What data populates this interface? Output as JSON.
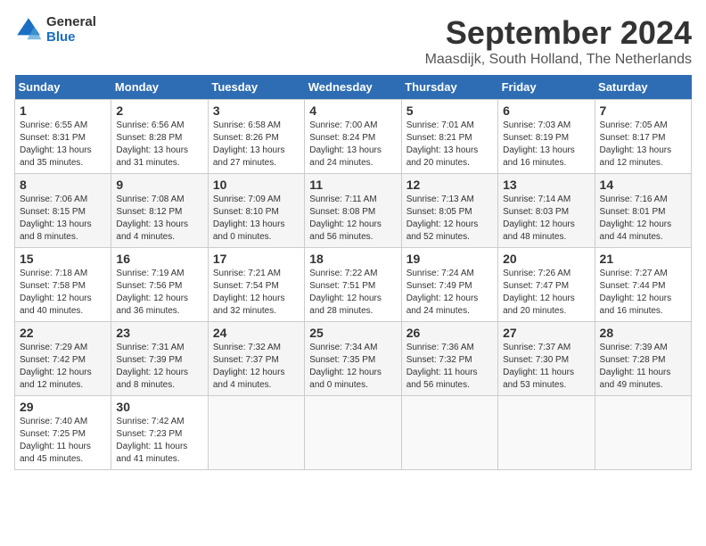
{
  "header": {
    "logo_line1": "General",
    "logo_line2": "Blue",
    "month_title": "September 2024",
    "location": "Maasdijk, South Holland, The Netherlands"
  },
  "days_of_week": [
    "Sunday",
    "Monday",
    "Tuesday",
    "Wednesday",
    "Thursday",
    "Friday",
    "Saturday"
  ],
  "weeks": [
    [
      {
        "day": "1",
        "info": "Sunrise: 6:55 AM\nSunset: 8:31 PM\nDaylight: 13 hours and 35 minutes."
      },
      {
        "day": "2",
        "info": "Sunrise: 6:56 AM\nSunset: 8:28 PM\nDaylight: 13 hours and 31 minutes."
      },
      {
        "day": "3",
        "info": "Sunrise: 6:58 AM\nSunset: 8:26 PM\nDaylight: 13 hours and 27 minutes."
      },
      {
        "day": "4",
        "info": "Sunrise: 7:00 AM\nSunset: 8:24 PM\nDaylight: 13 hours and 24 minutes."
      },
      {
        "day": "5",
        "info": "Sunrise: 7:01 AM\nSunset: 8:21 PM\nDaylight: 13 hours and 20 minutes."
      },
      {
        "day": "6",
        "info": "Sunrise: 7:03 AM\nSunset: 8:19 PM\nDaylight: 13 hours and 16 minutes."
      },
      {
        "day": "7",
        "info": "Sunrise: 7:05 AM\nSunset: 8:17 PM\nDaylight: 13 hours and 12 minutes."
      }
    ],
    [
      {
        "day": "8",
        "info": "Sunrise: 7:06 AM\nSunset: 8:15 PM\nDaylight: 13 hours and 8 minutes."
      },
      {
        "day": "9",
        "info": "Sunrise: 7:08 AM\nSunset: 8:12 PM\nDaylight: 13 hours and 4 minutes."
      },
      {
        "day": "10",
        "info": "Sunrise: 7:09 AM\nSunset: 8:10 PM\nDaylight: 13 hours and 0 minutes."
      },
      {
        "day": "11",
        "info": "Sunrise: 7:11 AM\nSunset: 8:08 PM\nDaylight: 12 hours and 56 minutes."
      },
      {
        "day": "12",
        "info": "Sunrise: 7:13 AM\nSunset: 8:05 PM\nDaylight: 12 hours and 52 minutes."
      },
      {
        "day": "13",
        "info": "Sunrise: 7:14 AM\nSunset: 8:03 PM\nDaylight: 12 hours and 48 minutes."
      },
      {
        "day": "14",
        "info": "Sunrise: 7:16 AM\nSunset: 8:01 PM\nDaylight: 12 hours and 44 minutes."
      }
    ],
    [
      {
        "day": "15",
        "info": "Sunrise: 7:18 AM\nSunset: 7:58 PM\nDaylight: 12 hours and 40 minutes."
      },
      {
        "day": "16",
        "info": "Sunrise: 7:19 AM\nSunset: 7:56 PM\nDaylight: 12 hours and 36 minutes."
      },
      {
        "day": "17",
        "info": "Sunrise: 7:21 AM\nSunset: 7:54 PM\nDaylight: 12 hours and 32 minutes."
      },
      {
        "day": "18",
        "info": "Sunrise: 7:22 AM\nSunset: 7:51 PM\nDaylight: 12 hours and 28 minutes."
      },
      {
        "day": "19",
        "info": "Sunrise: 7:24 AM\nSunset: 7:49 PM\nDaylight: 12 hours and 24 minutes."
      },
      {
        "day": "20",
        "info": "Sunrise: 7:26 AM\nSunset: 7:47 PM\nDaylight: 12 hours and 20 minutes."
      },
      {
        "day": "21",
        "info": "Sunrise: 7:27 AM\nSunset: 7:44 PM\nDaylight: 12 hours and 16 minutes."
      }
    ],
    [
      {
        "day": "22",
        "info": "Sunrise: 7:29 AM\nSunset: 7:42 PM\nDaylight: 12 hours and 12 minutes."
      },
      {
        "day": "23",
        "info": "Sunrise: 7:31 AM\nSunset: 7:39 PM\nDaylight: 12 hours and 8 minutes."
      },
      {
        "day": "24",
        "info": "Sunrise: 7:32 AM\nSunset: 7:37 PM\nDaylight: 12 hours and 4 minutes."
      },
      {
        "day": "25",
        "info": "Sunrise: 7:34 AM\nSunset: 7:35 PM\nDaylight: 12 hours and 0 minutes."
      },
      {
        "day": "26",
        "info": "Sunrise: 7:36 AM\nSunset: 7:32 PM\nDaylight: 11 hours and 56 minutes."
      },
      {
        "day": "27",
        "info": "Sunrise: 7:37 AM\nSunset: 7:30 PM\nDaylight: 11 hours and 53 minutes."
      },
      {
        "day": "28",
        "info": "Sunrise: 7:39 AM\nSunset: 7:28 PM\nDaylight: 11 hours and 49 minutes."
      }
    ],
    [
      {
        "day": "29",
        "info": "Sunrise: 7:40 AM\nSunset: 7:25 PM\nDaylight: 11 hours and 45 minutes."
      },
      {
        "day": "30",
        "info": "Sunrise: 7:42 AM\nSunset: 7:23 PM\nDaylight: 11 hours and 41 minutes."
      },
      {
        "day": "",
        "info": ""
      },
      {
        "day": "",
        "info": ""
      },
      {
        "day": "",
        "info": ""
      },
      {
        "day": "",
        "info": ""
      },
      {
        "day": "",
        "info": ""
      }
    ]
  ]
}
